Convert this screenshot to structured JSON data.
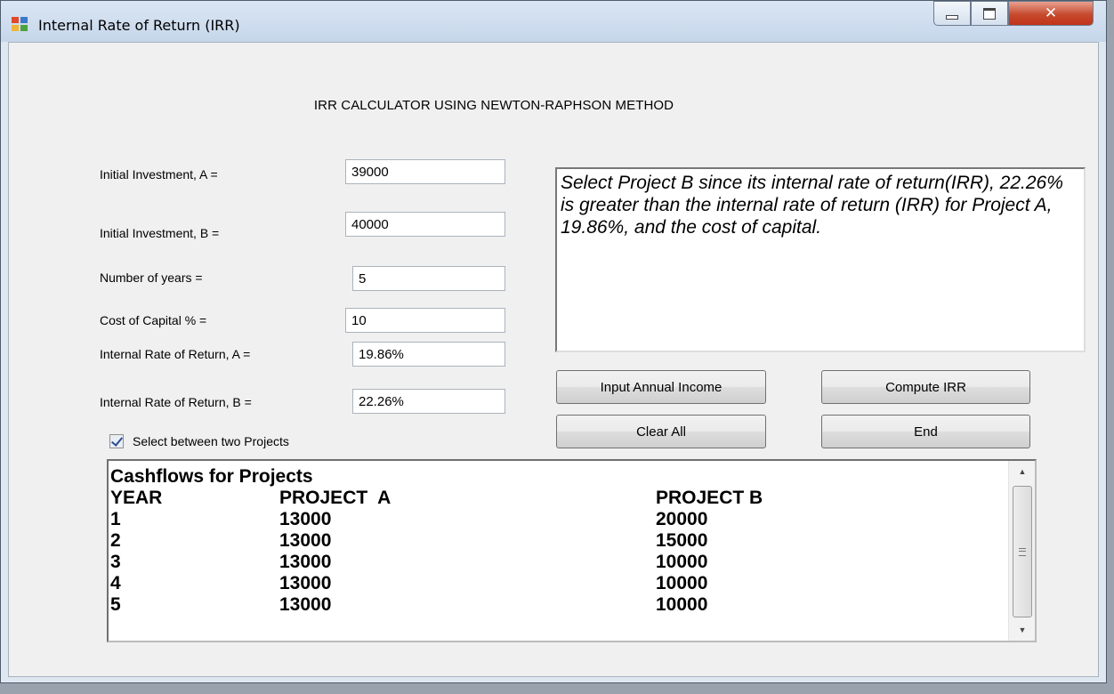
{
  "window": {
    "title": "Internal Rate of Return (IRR)",
    "icons": {
      "app": "app-window-icon",
      "minimize": "minimize-icon",
      "maximize": "maximize-icon",
      "close": "close-icon"
    }
  },
  "heading": "IRR CALCULATOR USING NEWTON-RAPHSON METHOD",
  "form": {
    "investment_a_label": "Initial Investment, A =",
    "investment_a_value": "39000",
    "investment_b_label": "Initial Investment, B =",
    "investment_b_value": "40000",
    "years_label": "Number of years =",
    "years_value": "5",
    "cost_label": "Cost of Capital % =",
    "cost_value": "10",
    "irr_a_label": "Internal Rate of Return, A =",
    "irr_a_value": "19.86%",
    "irr_b_label": "Internal Rate of Return, B =",
    "irr_b_value": "22.26%"
  },
  "result_text": "Select Project B since its internal rate of return(IRR), 22.26% is greater than the internal rate of return (IRR) for Project A, 19.86%, and the cost of capital.",
  "buttons": {
    "input_income": "Input Annual Income",
    "compute": "Compute IRR",
    "clear": "Clear All",
    "end": "End"
  },
  "checkbox": {
    "label": "Select between two Projects",
    "checked": true
  },
  "cashflows": {
    "title": "Cashflows for Projects",
    "headers": [
      "YEAR",
      "PROJECT  A",
      "PROJECT B"
    ],
    "rows": [
      [
        "1",
        "13000",
        "20000"
      ],
      [
        "2",
        "13000",
        "15000"
      ],
      [
        "3",
        "13000",
        "10000"
      ],
      [
        "4",
        "13000",
        "10000"
      ],
      [
        "5",
        "13000",
        "10000"
      ]
    ]
  },
  "colors": {
    "titlebar": "#c9d8eb",
    "close_button": "#c7452a",
    "client_bg": "#f0f0f0"
  }
}
